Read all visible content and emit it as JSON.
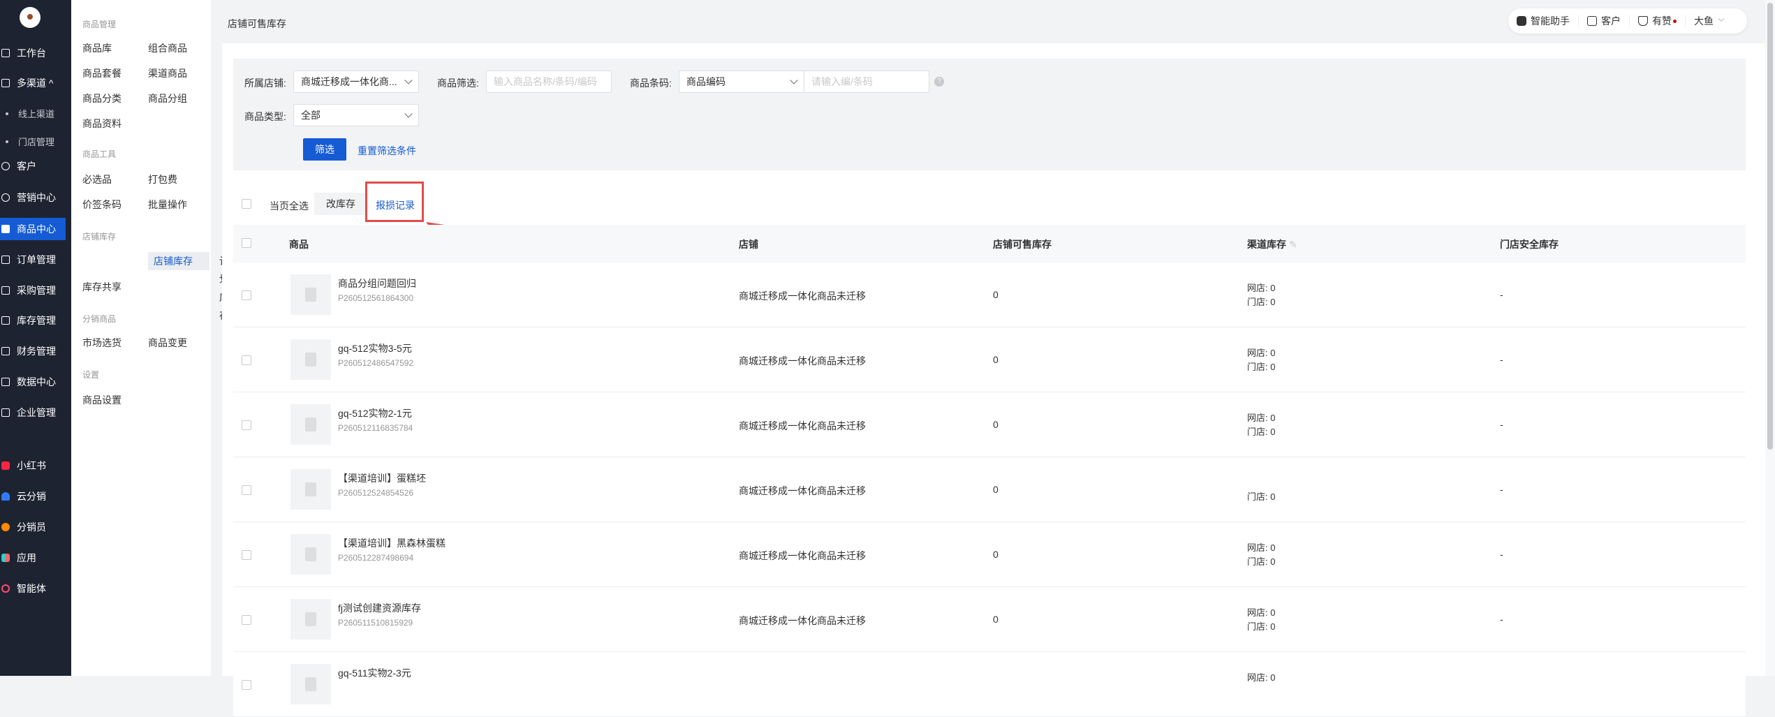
{
  "nav": {
    "items": [
      {
        "label": "工作台"
      },
      {
        "label": "多渠道 ^"
      },
      {
        "label": "线上渠道"
      },
      {
        "label": "门店管理"
      },
      {
        "label": "客户"
      },
      {
        "label": "营销中心"
      },
      {
        "label": "商品中心"
      },
      {
        "label": "订单管理"
      },
      {
        "label": "采购管理"
      },
      {
        "label": "库存管理"
      },
      {
        "label": "财务管理"
      },
      {
        "label": "数据中心"
      },
      {
        "label": "企业管理"
      },
      {
        "label": "小红书"
      },
      {
        "label": "云分销"
      },
      {
        "label": "分销员"
      },
      {
        "label": "应用"
      },
      {
        "label": "智能体"
      }
    ]
  },
  "subnav": {
    "group1": "商品管理",
    "g1_items": [
      "商品库",
      "组合商品",
      "商品套餐",
      "渠道商品",
      "商品分类",
      "商品分组",
      "商品资料"
    ],
    "group2": "商品工具",
    "g2_items": [
      "必选品",
      "打包费",
      "价签条码",
      "批量操作"
    ],
    "group3": "店铺库存",
    "g3_items": [
      "店铺库存",
      "计划库存",
      "库存共享"
    ],
    "group4": "分销商品",
    "g4_items": [
      "市场选货",
      "商品变更"
    ],
    "group5": "设置",
    "g5_items": [
      "商品设置"
    ]
  },
  "header": {
    "title": "店铺可售库存",
    "assistant": "智能助手",
    "customer": "客户",
    "like": "有赞",
    "user": "大鱼"
  },
  "filter": {
    "shop_label": "所属店铺:",
    "shop_value": "商城迁移成一体化商...",
    "goods_filter_label": "商品筛选:",
    "goods_filter_placeholder": "输入商品名称/条码/编码",
    "barcode_label": "商品条码:",
    "barcode_select": "商品编码",
    "barcode_placeholder": "请输入编/条码",
    "type_label": "商品类型:",
    "type_value": "全部",
    "filter_button": "筛选",
    "reset_link": "重置筛选条件"
  },
  "toolbar": {
    "select_all": "当页全选",
    "edit_stock": "改库存",
    "damage_record": "报损记录"
  },
  "table": {
    "headers": {
      "goods": "商品",
      "shop": "店铺",
      "shop_stock": "店铺可售库存",
      "channel_stock": "渠道库存",
      "safe_stock": "门店安全库存"
    },
    "rows": [
      {
        "name": "商品分组问题回归",
        "code": "P260512561864300",
        "shop": "商城迁移成一体化商品未迁移",
        "stock": "0",
        "ch1": "网店: 0",
        "ch2": "门店: 0",
        "safe": "-"
      },
      {
        "name": "gq-512实物3-5元",
        "code": "P260512486547592",
        "shop": "商城迁移成一体化商品未迁移",
        "stock": "0",
        "ch1": "网店: 0",
        "ch2": "门店: 0",
        "safe": "-"
      },
      {
        "name": "gq-512实物2-1元",
        "code": "P260512116835784",
        "shop": "商城迁移成一体化商品未迁移",
        "stock": "0",
        "ch1": "网店: 0",
        "ch2": "门店: 0",
        "safe": "-"
      },
      {
        "name": "【渠道培训】蛋糕坯",
        "code": "P260512524854526",
        "shop": "商城迁移成一体化商品未迁移",
        "stock": "0",
        "ch1": "",
        "ch2": "门店: 0",
        "safe": "-"
      },
      {
        "name": "【渠道培训】黑森林蛋糕",
        "code": "P260512287498694",
        "shop": "商城迁移成一体化商品未迁移",
        "stock": "0",
        "ch1": "网店: 0",
        "ch2": "门店: 0",
        "safe": "-"
      },
      {
        "name": "fj测试创建资源库存",
        "code": "P260511510815929",
        "shop": "商城迁移成一体化商品未迁移",
        "stock": "0",
        "ch1": "网店: 0",
        "ch2": "门店: 0",
        "safe": "-"
      },
      {
        "name": "gq-511实物2-3元",
        "code": "",
        "shop": "",
        "stock": "",
        "ch1": "网店: 0",
        "ch2": "",
        "safe": ""
      }
    ]
  },
  "colors": {
    "accent": "#155bd4",
    "nav_bg": "#1e2331",
    "annotation": "#e14b4b"
  }
}
